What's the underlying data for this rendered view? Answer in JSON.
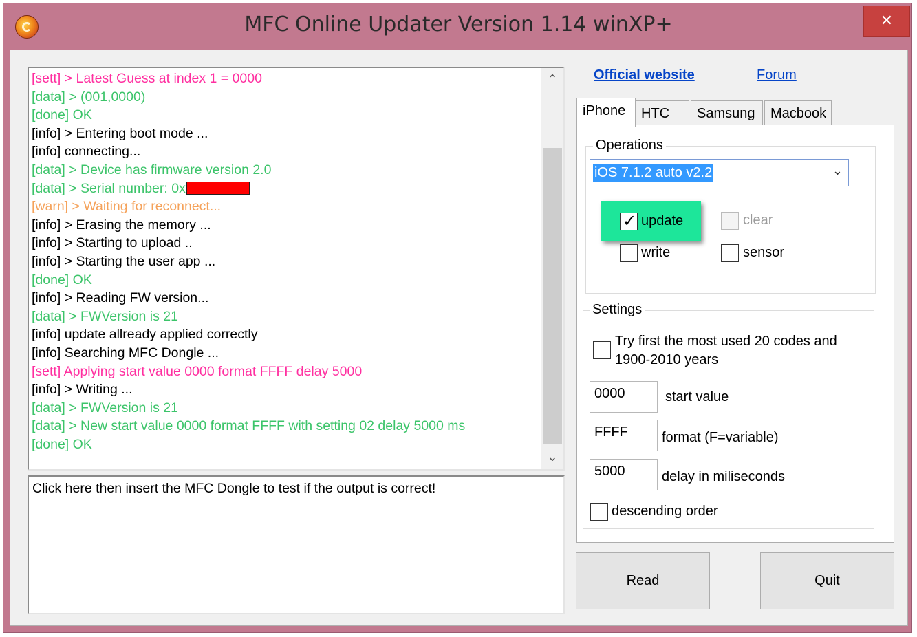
{
  "window": {
    "title": "MFC Online Updater Version 1.14 winXP+",
    "close_label": "✕"
  },
  "log": {
    "lines": [
      {
        "tag": "sett",
        "text": "[sett] > Latest Guess at index 1 = 0000"
      },
      {
        "tag": "data",
        "text": "[data] >  (001,0000)"
      },
      {
        "tag": "done",
        "text": "[done] OK"
      },
      {
        "tag": "info",
        "text": "[info] > Entering boot mode ..."
      },
      {
        "tag": "info",
        "text": "[info] connecting..."
      },
      {
        "tag": "data",
        "text": "[data] > Device has firmware version 2.0"
      },
      {
        "tag": "data",
        "text": "[data] > Serial number: 0x",
        "redacted": true
      },
      {
        "tag": "warn",
        "text": "[warn] > Waiting for reconnect..."
      },
      {
        "tag": "info",
        "text": "[info] > Erasing the memory ..."
      },
      {
        "tag": "info",
        "text": "[info] > Starting to upload .."
      },
      {
        "tag": "info",
        "text": "[info] > Starting the user app ..."
      },
      {
        "tag": "done",
        "text": "[done] OK"
      },
      {
        "tag": "info",
        "text": "[info] > Reading FW version..."
      },
      {
        "tag": "data",
        "text": "[data] > FWVersion is 21"
      },
      {
        "tag": "info",
        "text": "[info] update allready applied correctly"
      },
      {
        "tag": "info",
        "text": "[info] Searching MFC Dongle ..."
      },
      {
        "tag": "sett",
        "text": "[sett] Applying start value 0000 format FFFF delay 5000"
      },
      {
        "tag": "info",
        "text": "[info] > Writing ..."
      },
      {
        "tag": "data",
        "text": "[data] > FWVersion is 21"
      },
      {
        "tag": "data",
        "text": "[data] > New start value 0000 format FFFF with setting 02 delay 5000 ms"
      },
      {
        "tag": "done",
        "text": "[done] OK"
      }
    ],
    "colors": {
      "sett": "#ff2fa0",
      "data": "#3cc46a",
      "done": "#3cc46a",
      "info": "#000000",
      "warn": "#f5a25a"
    }
  },
  "test_area": {
    "text": "Click here then insert the MFC Dongle to test if the output is correct!"
  },
  "links": {
    "official": "Official website",
    "forum": "Forum"
  },
  "tabs": [
    {
      "label": "iPhone",
      "active": true
    },
    {
      "label": "HTC",
      "active": false
    },
    {
      "label": "Samsung",
      "active": false
    },
    {
      "label": "Macbook",
      "active": false
    }
  ],
  "operations": {
    "label": "Operations",
    "selected": "iOS 7.1.2 auto v2.2",
    "checkboxes": {
      "update": {
        "label": "update",
        "checked": true
      },
      "clear": {
        "label": "clear",
        "checked": false,
        "disabled": true
      },
      "write": {
        "label": "write",
        "checked": false
      },
      "sensor": {
        "label": "sensor",
        "checked": false
      }
    }
  },
  "settings": {
    "label": "Settings",
    "try_first_line1": "Try first the most used 20 codes and",
    "try_first_line2": "1900-2010 years",
    "start_value": "0000",
    "start_value_label": "start value",
    "format": "FFFF",
    "format_label": "format (F=variable)",
    "delay": "5000",
    "delay_label": "delay in miliseconds",
    "descending_label": "descending order"
  },
  "buttons": {
    "read": "Read",
    "quit": "Quit"
  }
}
